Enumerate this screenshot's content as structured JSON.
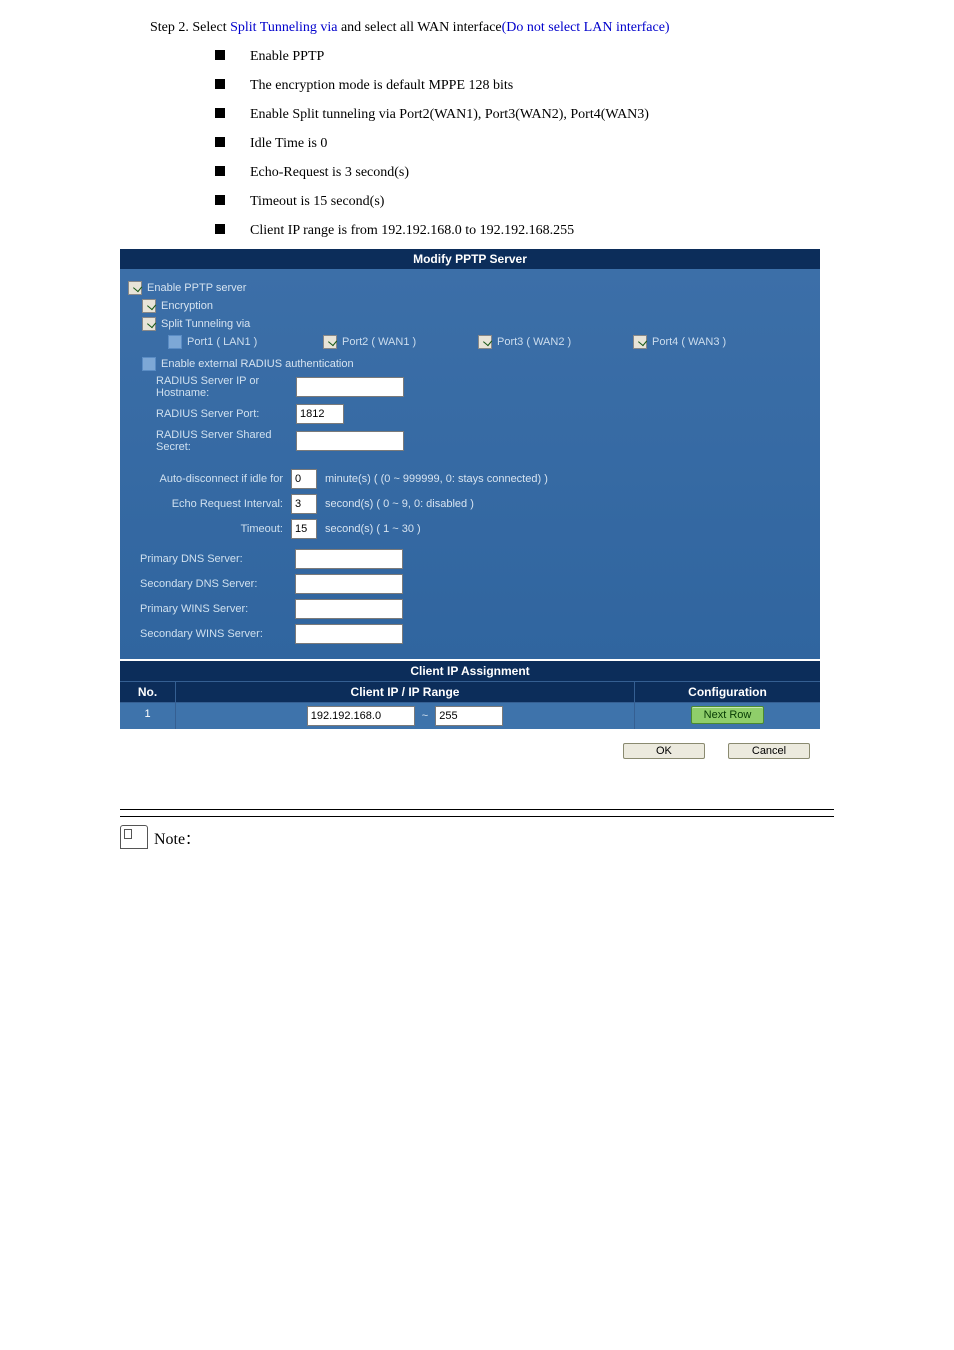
{
  "step2": {
    "prefix": "Step 2.",
    "text_before": " Select ",
    "emph1": "Split Tunneling via",
    "text_mid": " and select all WAN interface",
    "emph2": "(Do not select LAN interface)"
  },
  "bullets": [
    "Enable PPTP",
    "The encryption mode is default MPPE 128 bits",
    "Enable Split tunneling via Port2(WAN1), Port3(WAN2), Port4(WAN3)",
    "Idle Time is 0",
    "Echo-Request is 3 second(s)",
    "Timeout is 15 second(s)",
    "Client IP range is from 192.192.168.0 to 192.192.168.255"
  ],
  "ui": {
    "title": "Modify PPTP Server",
    "enable": "Enable PPTP server",
    "encryption": "Encryption",
    "split": "Split Tunneling via",
    "ports": [
      {
        "label": "Port1 ( LAN1 )",
        "checked": false
      },
      {
        "label": "Port2 ( WAN1 )",
        "checked": true
      },
      {
        "label": "Port3 ( WAN2 )",
        "checked": true
      },
      {
        "label": "Port4 ( WAN3 )",
        "checked": true
      }
    ],
    "radius": {
      "enable": "Enable external RADIUS authentication",
      "ip_label": "RADIUS Server IP or Hostname:",
      "port_label": "RADIUS Server Port:",
      "port_value": "1812",
      "secret_label": "RADIUS Server Shared Secret:"
    },
    "idle": {
      "label": "Auto-disconnect if idle for",
      "value": "0",
      "hint": "minute(s) ( (0 ~ 999999, 0: stays connected) )"
    },
    "echo": {
      "label": "Echo Request Interval:",
      "value": "3",
      "hint": "second(s) ( 0 ~ 9, 0: disabled )"
    },
    "timeout": {
      "label": "Timeout:",
      "value": "15",
      "hint": "second(s) ( 1 ~ 30 )"
    },
    "dns_primary": "Primary DNS Server:",
    "dns_secondary": "Secondary DNS Server:",
    "wins_primary": "Primary WINS Server:",
    "wins_secondary": "Secondary WINS Server:",
    "cia": {
      "title": "Client IP Assignment",
      "h_no": "No.",
      "h_ip": "Client IP / IP Range",
      "h_cfg": "Configuration",
      "row_no": "1",
      "ip_start": "192.192.168.0",
      "ip_end": "255",
      "btn_next": "Next Row"
    },
    "ok": "OK",
    "cancel": "Cancel"
  },
  "note": "Note",
  "colon": "："
}
